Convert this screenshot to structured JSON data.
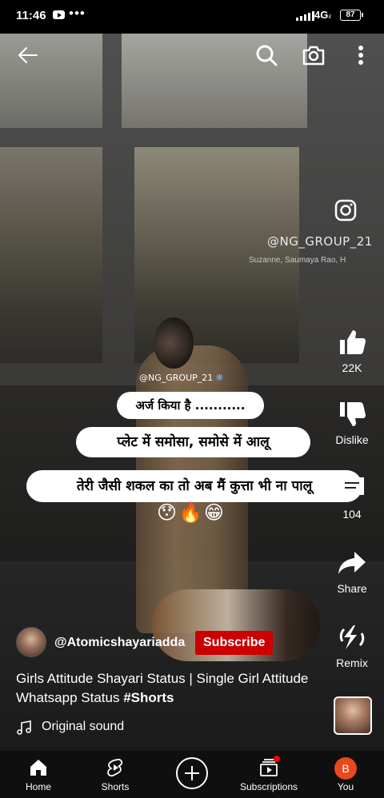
{
  "status_bar": {
    "time": "11:46",
    "network": "4G",
    "network_sub": "ıl",
    "battery": "87"
  },
  "video_overlay": {
    "watermark_handle": "@NG_GROUP_21",
    "watermark_credit": "Suzanne, Saumaya Rao, H",
    "small_handle": "@NG_GROUP_21",
    "line1": "अर्ज किया है ...........",
    "line2": "प्लेट में समोसा,  समोसे में आलू",
    "line3": "तेरी जैसी शकल का  तो  अब मैं  कुत्ता भी  ना पालू",
    "emojis": "😯🔥😁"
  },
  "actions": {
    "like_count": "22K",
    "dislike_label": "Dislike",
    "comment_count": "104",
    "share_label": "Share",
    "remix_label": "Remix"
  },
  "channel": {
    "name": "@Atomicshayariadda",
    "subscribe_label": "Subscribe"
  },
  "video": {
    "title_plain": "Girls Attitude Shayari Status | Single Girl Attitude Whatsapp Status",
    "title_tag": "#Shorts",
    "sound": "Original sound"
  },
  "bottom_nav": {
    "home": "Home",
    "shorts": "Shorts",
    "subscriptions": "Subscriptions",
    "you": "You",
    "you_initial": "B"
  },
  "colors": {
    "subscribe_bg": "#cc0000",
    "nav_bg": "#0f0f0f",
    "you_avatar": "#e8481e"
  }
}
